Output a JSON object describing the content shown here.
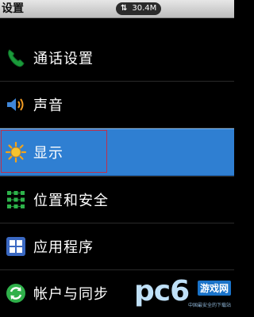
{
  "status": {
    "title": "设置",
    "speed_arrows": "⇅",
    "speed": "30.4M"
  },
  "menu": {
    "items": [
      {
        "label": "通话设置",
        "icon": "phone-icon"
      },
      {
        "label": "声音",
        "icon": "speaker-icon"
      },
      {
        "label": "显示",
        "icon": "brightness-icon",
        "selected": true
      },
      {
        "label": "位置和安全",
        "icon": "grid-location-icon"
      },
      {
        "label": "应用程序",
        "icon": "apps-icon"
      },
      {
        "label": "帐户与同步",
        "icon": "sync-icon"
      }
    ]
  },
  "watermark": {
    "brand": "pc6",
    "tag": "游戏网",
    "sub": "中国最安全的下载站"
  },
  "colors": {
    "selected_bg": "#2f7fd2",
    "accent_green": "#1a9a3a"
  }
}
